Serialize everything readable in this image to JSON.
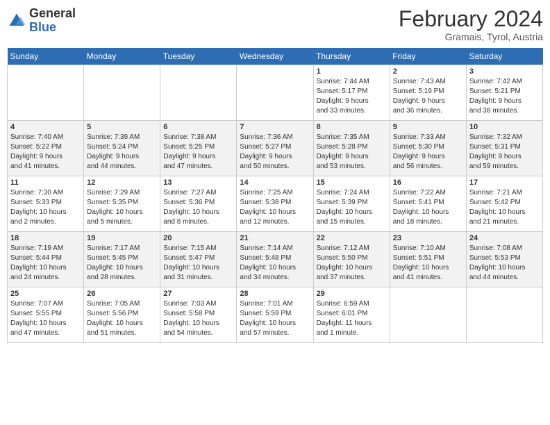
{
  "logo": {
    "general": "General",
    "blue": "Blue"
  },
  "title": {
    "month_year": "February 2024",
    "location": "Gramais, Tyrol, Austria"
  },
  "weekdays": [
    "Sunday",
    "Monday",
    "Tuesday",
    "Wednesday",
    "Thursday",
    "Friday",
    "Saturday"
  ],
  "weeks": [
    [
      {
        "day": "",
        "info": ""
      },
      {
        "day": "",
        "info": ""
      },
      {
        "day": "",
        "info": ""
      },
      {
        "day": "",
        "info": ""
      },
      {
        "day": "1",
        "info": "Sunrise: 7:44 AM\nSunset: 5:17 PM\nDaylight: 9 hours\nand 33 minutes."
      },
      {
        "day": "2",
        "info": "Sunrise: 7:43 AM\nSunset: 5:19 PM\nDaylight: 9 hours\nand 36 minutes."
      },
      {
        "day": "3",
        "info": "Sunrise: 7:42 AM\nSunset: 5:21 PM\nDaylight: 9 hours\nand 38 minutes."
      }
    ],
    [
      {
        "day": "4",
        "info": "Sunrise: 7:40 AM\nSunset: 5:22 PM\nDaylight: 9 hours\nand 41 minutes."
      },
      {
        "day": "5",
        "info": "Sunrise: 7:39 AM\nSunset: 5:24 PM\nDaylight: 9 hours\nand 44 minutes."
      },
      {
        "day": "6",
        "info": "Sunrise: 7:38 AM\nSunset: 5:25 PM\nDaylight: 9 hours\nand 47 minutes."
      },
      {
        "day": "7",
        "info": "Sunrise: 7:36 AM\nSunset: 5:27 PM\nDaylight: 9 hours\nand 50 minutes."
      },
      {
        "day": "8",
        "info": "Sunrise: 7:35 AM\nSunset: 5:28 PM\nDaylight: 9 hours\nand 53 minutes."
      },
      {
        "day": "9",
        "info": "Sunrise: 7:33 AM\nSunset: 5:30 PM\nDaylight: 9 hours\nand 56 minutes."
      },
      {
        "day": "10",
        "info": "Sunrise: 7:32 AM\nSunset: 5:31 PM\nDaylight: 9 hours\nand 59 minutes."
      }
    ],
    [
      {
        "day": "11",
        "info": "Sunrise: 7:30 AM\nSunset: 5:33 PM\nDaylight: 10 hours\nand 2 minutes."
      },
      {
        "day": "12",
        "info": "Sunrise: 7:29 AM\nSunset: 5:35 PM\nDaylight: 10 hours\nand 5 minutes."
      },
      {
        "day": "13",
        "info": "Sunrise: 7:27 AM\nSunset: 5:36 PM\nDaylight: 10 hours\nand 8 minutes."
      },
      {
        "day": "14",
        "info": "Sunrise: 7:25 AM\nSunset: 5:38 PM\nDaylight: 10 hours\nand 12 minutes."
      },
      {
        "day": "15",
        "info": "Sunrise: 7:24 AM\nSunset: 5:39 PM\nDaylight: 10 hours\nand 15 minutes."
      },
      {
        "day": "16",
        "info": "Sunrise: 7:22 AM\nSunset: 5:41 PM\nDaylight: 10 hours\nand 18 minutes."
      },
      {
        "day": "17",
        "info": "Sunrise: 7:21 AM\nSunset: 5:42 PM\nDaylight: 10 hours\nand 21 minutes."
      }
    ],
    [
      {
        "day": "18",
        "info": "Sunrise: 7:19 AM\nSunset: 5:44 PM\nDaylight: 10 hours\nand 24 minutes."
      },
      {
        "day": "19",
        "info": "Sunrise: 7:17 AM\nSunset: 5:45 PM\nDaylight: 10 hours\nand 28 minutes."
      },
      {
        "day": "20",
        "info": "Sunrise: 7:15 AM\nSunset: 5:47 PM\nDaylight: 10 hours\nand 31 minutes."
      },
      {
        "day": "21",
        "info": "Sunrise: 7:14 AM\nSunset: 5:48 PM\nDaylight: 10 hours\nand 34 minutes."
      },
      {
        "day": "22",
        "info": "Sunrise: 7:12 AM\nSunset: 5:50 PM\nDaylight: 10 hours\nand 37 minutes."
      },
      {
        "day": "23",
        "info": "Sunrise: 7:10 AM\nSunset: 5:51 PM\nDaylight: 10 hours\nand 41 minutes."
      },
      {
        "day": "24",
        "info": "Sunrise: 7:08 AM\nSunset: 5:53 PM\nDaylight: 10 hours\nand 44 minutes."
      }
    ],
    [
      {
        "day": "25",
        "info": "Sunrise: 7:07 AM\nSunset: 5:55 PM\nDaylight: 10 hours\nand 47 minutes."
      },
      {
        "day": "26",
        "info": "Sunrise: 7:05 AM\nSunset: 5:56 PM\nDaylight: 10 hours\nand 51 minutes."
      },
      {
        "day": "27",
        "info": "Sunrise: 7:03 AM\nSunset: 5:58 PM\nDaylight: 10 hours\nand 54 minutes."
      },
      {
        "day": "28",
        "info": "Sunrise: 7:01 AM\nSunset: 5:59 PM\nDaylight: 10 hours\nand 57 minutes."
      },
      {
        "day": "29",
        "info": "Sunrise: 6:59 AM\nSunset: 6:01 PM\nDaylight: 11 hours\nand 1 minute."
      },
      {
        "day": "",
        "info": ""
      },
      {
        "day": "",
        "info": ""
      }
    ]
  ]
}
